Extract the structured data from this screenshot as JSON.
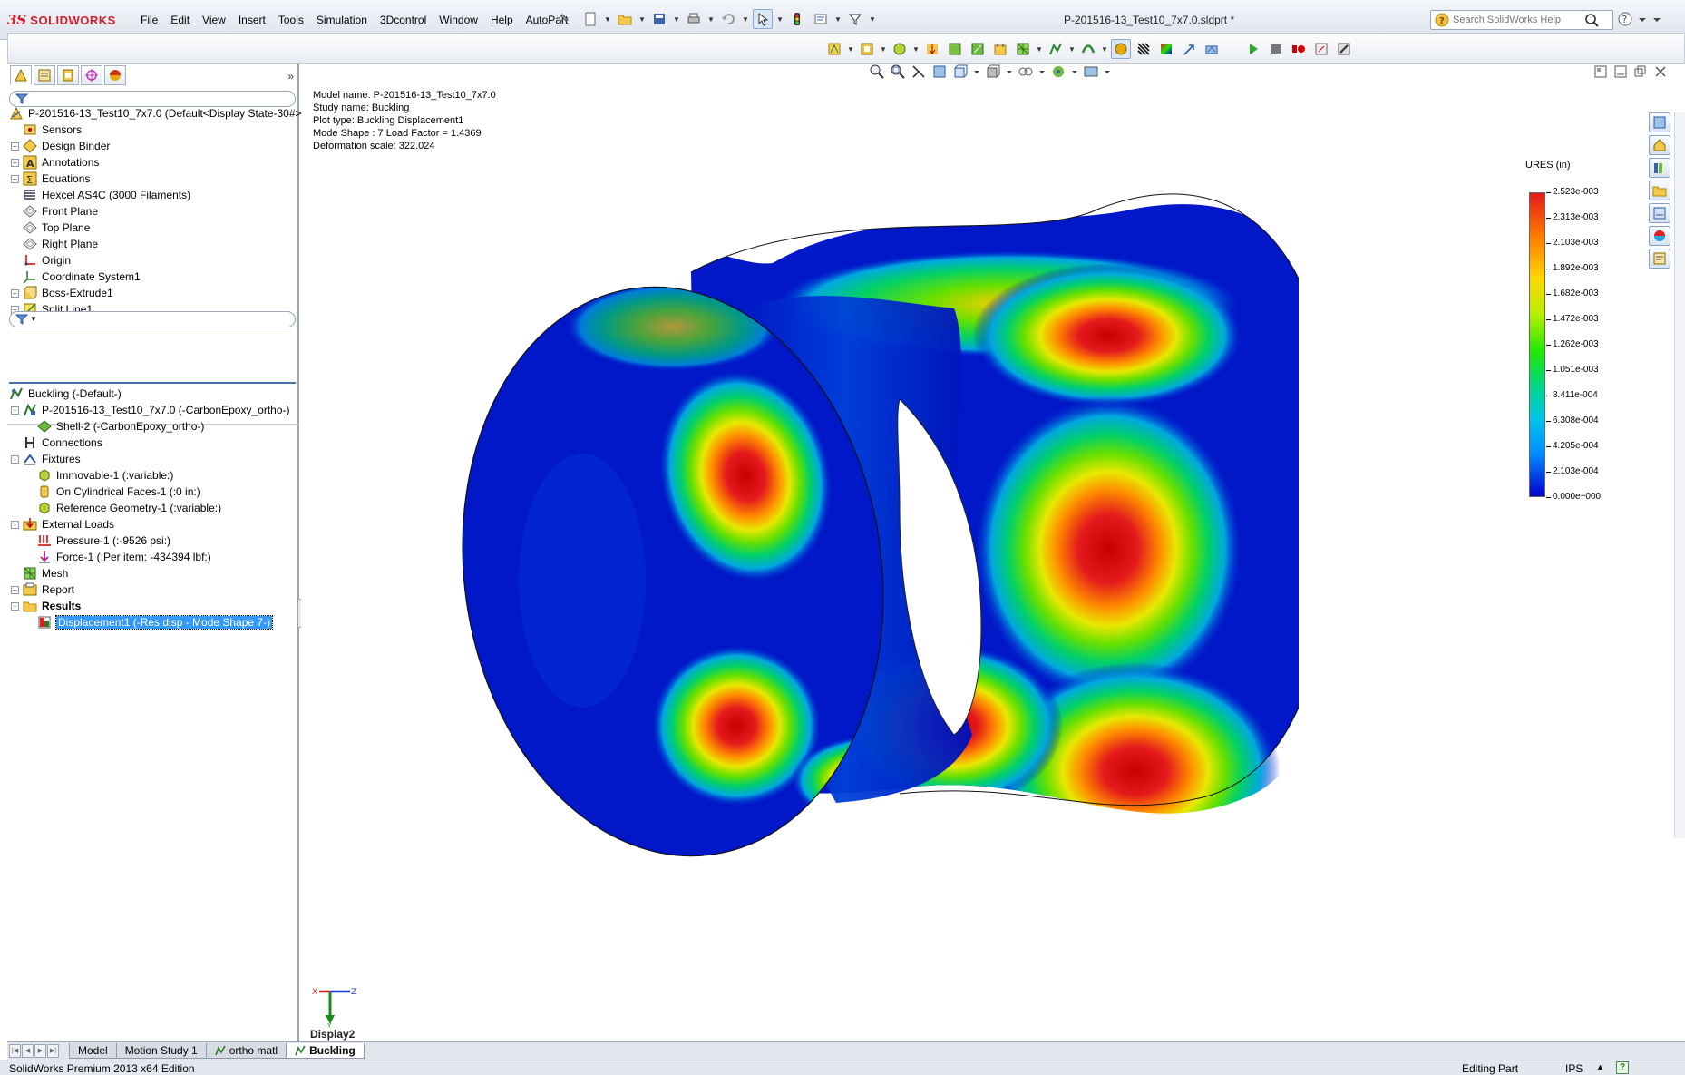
{
  "app": {
    "logo_ds": "3S",
    "logo_brand": "SOLIDWORKS",
    "document_title": "P-201516-13_Test10_7x7.0.sldprt *"
  },
  "menu": [
    "File",
    "Edit",
    "View",
    "Insert",
    "Tools",
    "Simulation",
    "3Dcontrol",
    "Window",
    "Help",
    "AutoPart"
  ],
  "search": {
    "placeholder": "Search SolidWorks Help"
  },
  "feature_tree": {
    "root": "P-201516-13_Test10_7x7.0  (Default<Display State-30#>)",
    "items": [
      {
        "label": "Sensors",
        "icon": "sensor-icon",
        "expandable": false
      },
      {
        "label": "Design Binder",
        "icon": "binder-icon",
        "expandable": true
      },
      {
        "label": "Annotations",
        "icon": "annotation-icon",
        "expandable": true
      },
      {
        "label": "Equations",
        "icon": "equation-icon",
        "expandable": true
      },
      {
        "label": "Hexcel AS4C (3000 Filaments)",
        "icon": "material-icon",
        "expandable": false
      },
      {
        "label": "Front Plane",
        "icon": "plane-icon",
        "expandable": false
      },
      {
        "label": "Top Plane",
        "icon": "plane-icon",
        "expandable": false
      },
      {
        "label": "Right Plane",
        "icon": "plane-icon",
        "expandable": false
      },
      {
        "label": "Origin",
        "icon": "origin-icon",
        "expandable": false
      },
      {
        "label": "Coordinate System1",
        "icon": "coordinate-system-icon",
        "expandable": false
      },
      {
        "label": "Boss-Extrude1",
        "icon": "extrude-icon",
        "expandable": true
      },
      {
        "label": "Split Line1",
        "icon": "split-line-icon",
        "expandable": true
      }
    ]
  },
  "study_tree": {
    "root": "Buckling (-Default-)",
    "items": [
      {
        "label": "P-201516-13_Test10_7x7.0 (-CarbonEpoxy_ortho-)",
        "level": 1,
        "icon": "part-icon",
        "expander": "-"
      },
      {
        "label": "Shell-2 (-CarbonEpoxy_ortho-)",
        "level": 2,
        "icon": "shell-icon",
        "expander": ""
      },
      {
        "label": "Connections",
        "level": 1,
        "icon": "connections-icon",
        "expander": ""
      },
      {
        "label": "Fixtures",
        "level": 1,
        "icon": "fixtures-icon",
        "expander": "-"
      },
      {
        "label": "Immovable-1 (:variable:)",
        "level": 2,
        "icon": "fixture-icon",
        "expander": ""
      },
      {
        "label": "On Cylindrical Faces-1 (:0 in:)",
        "level": 2,
        "icon": "cylindrical-fixture-icon",
        "expander": ""
      },
      {
        "label": "Reference Geometry-1 (:variable:)",
        "level": 2,
        "icon": "fixture-icon",
        "expander": ""
      },
      {
        "label": "External Loads",
        "level": 1,
        "icon": "external-loads-icon",
        "expander": "-"
      },
      {
        "label": "Pressure-1 (:-9526 psi:)",
        "level": 2,
        "icon": "pressure-icon",
        "expander": ""
      },
      {
        "label": "Force-1 (:Per item: -434394 lbf:)",
        "level": 2,
        "icon": "force-icon",
        "expander": ""
      },
      {
        "label": "Mesh",
        "level": 1,
        "icon": "mesh-icon",
        "expander": ""
      },
      {
        "label": "Report",
        "level": 1,
        "icon": "report-icon",
        "expander": "+"
      },
      {
        "label": "Results",
        "level": 1,
        "icon": "results-icon",
        "expander": "-",
        "bold": true
      },
      {
        "label": "Displacement1 (-Res disp - Mode Shape 7-)",
        "level": 2,
        "icon": "plot-icon",
        "expander": "",
        "selected": true
      }
    ]
  },
  "plot_info": {
    "model_name": "Model name: P-201516-13_Test10_7x7.0",
    "study_name": "Study name: Buckling",
    "plot_type": "Plot type: Buckling Displacement1",
    "mode_shape": "Mode Shape : 7  Load Factor = 1.4369",
    "deformation_scale": "Deformation scale: 322.024"
  },
  "legend": {
    "title": "URES (in)",
    "ticks": [
      "2.523e-003",
      "2.313e-003",
      "2.103e-003",
      "1.892e-003",
      "1.682e-003",
      "1.472e-003",
      "1.262e-003",
      "1.051e-003",
      "8.411e-004",
      "6.308e-004",
      "4.205e-004",
      "2.103e-004",
      "0.000e+000"
    ]
  },
  "triad": {
    "x": "X",
    "y": "Y",
    "z": "Z"
  },
  "viewport_label": "Display2",
  "tabs": [
    {
      "label": "Model",
      "active": false,
      "icon": ""
    },
    {
      "label": "Motion Study 1",
      "active": false,
      "icon": ""
    },
    {
      "label": "ortho matl",
      "active": false,
      "icon": "study-icon"
    },
    {
      "label": "Buckling",
      "active": true,
      "icon": "buckling-study-icon"
    }
  ],
  "status": {
    "edition": "SolidWorks Premium 2013 x64 Edition",
    "mode": "Editing Part",
    "units": "IPS",
    "help": "?"
  },
  "colors": {
    "accent": "#3399ff",
    "brand": "#d0202e",
    "fringe_max": "#e41a1c",
    "fringe_min": "#0000d0"
  }
}
